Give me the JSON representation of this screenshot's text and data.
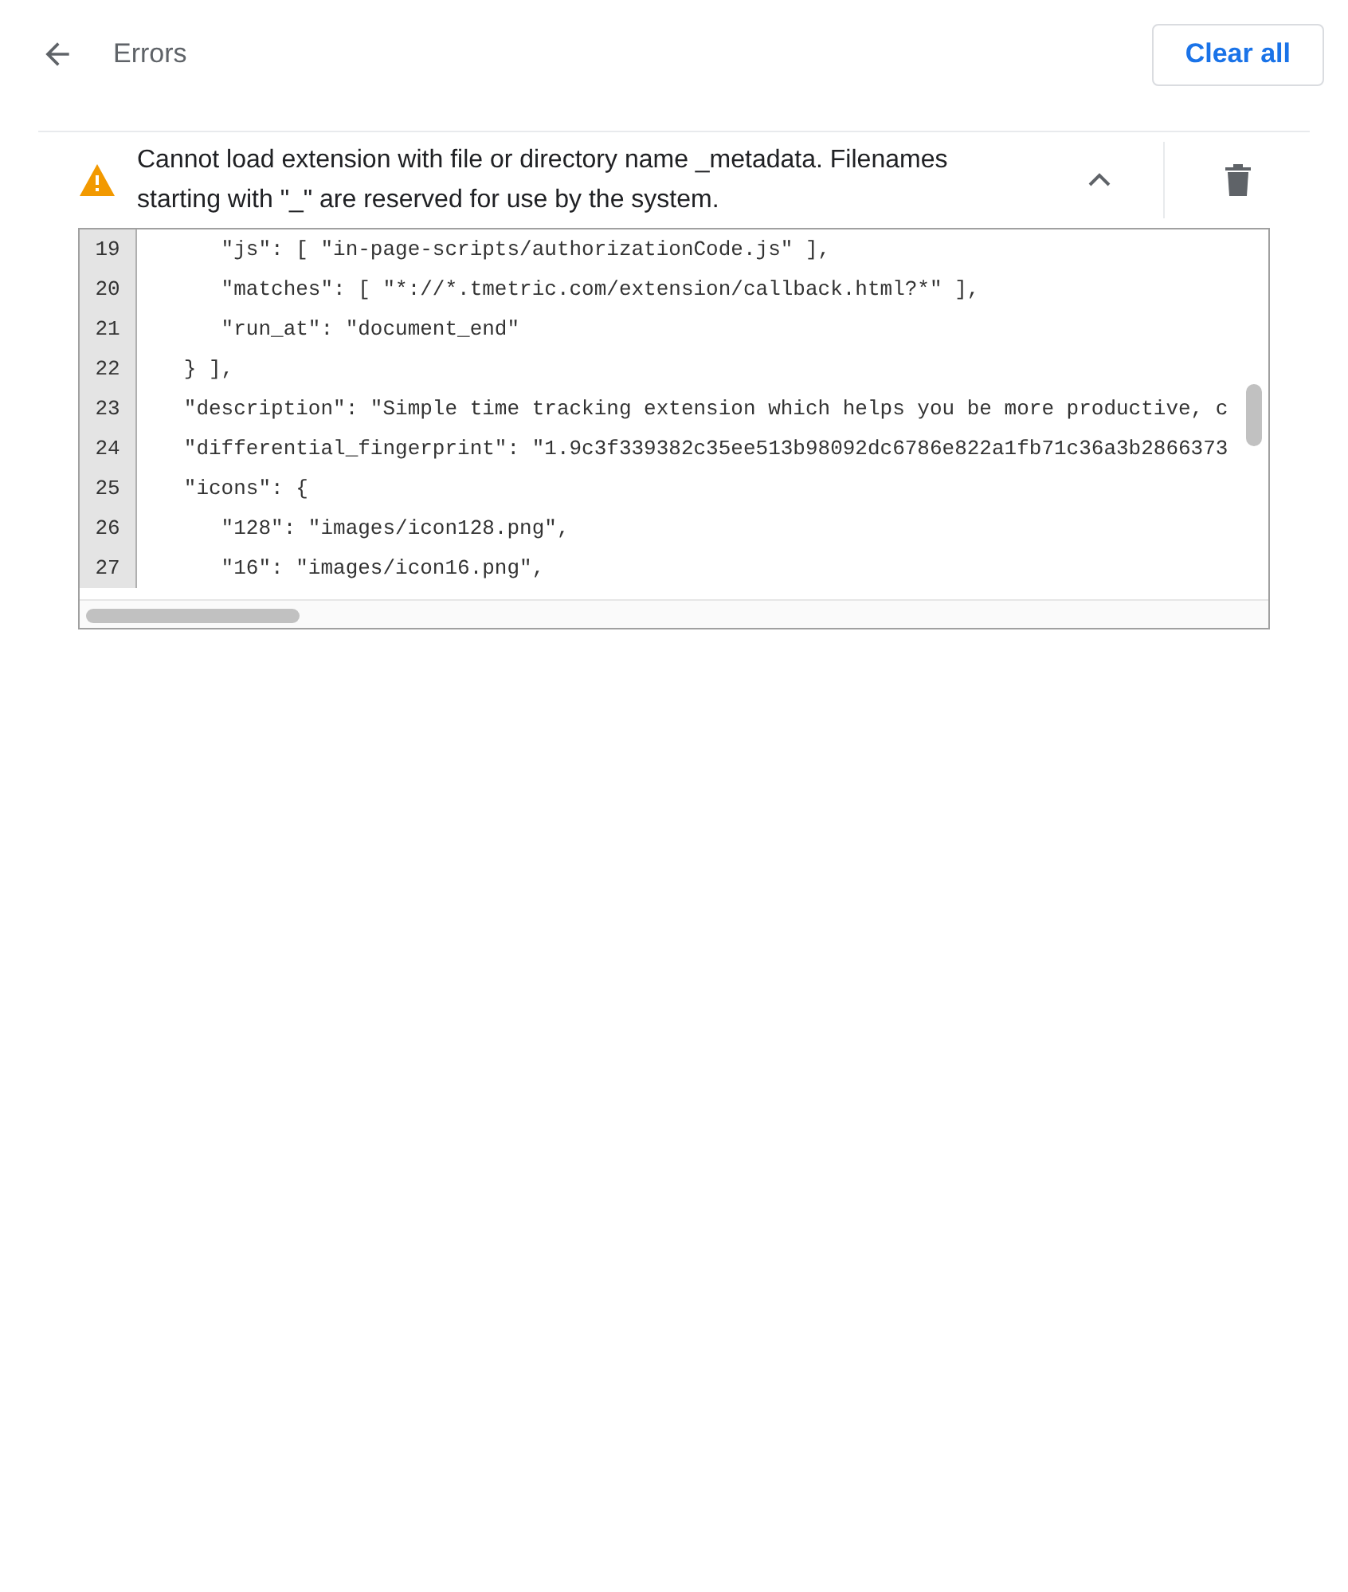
{
  "header": {
    "title": "Errors",
    "clear_button": "Clear all"
  },
  "error": {
    "message": "Cannot load extension with file or directory name _metadata. Filenames starting with \"_\" are reserved for use by the system.",
    "expanded": true,
    "code_lines": [
      {
        "number": "19",
        "text": "      \"js\": [ \"in-page-scripts/authorizationCode.js\" ],"
      },
      {
        "number": "20",
        "text": "      \"matches\": [ \"*://*.tmetric.com/extension/callback.html?*\" ],"
      },
      {
        "number": "21",
        "text": "      \"run_at\": \"document_end\""
      },
      {
        "number": "22",
        "text": "   } ],"
      },
      {
        "number": "23",
        "text": "   \"description\": \"Simple time tracking extension which helps you be more productive, c"
      },
      {
        "number": "24",
        "text": "   \"differential_fingerprint\": \"1.9c3f339382c35ee513b98092dc6786e822a1fb71c36a3b2866373"
      },
      {
        "number": "25",
        "text": "   \"icons\": {"
      },
      {
        "number": "26",
        "text": "      \"128\": \"images/icon128.png\","
      },
      {
        "number": "27",
        "text": "      \"16\": \"images/icon16.png\","
      }
    ]
  }
}
